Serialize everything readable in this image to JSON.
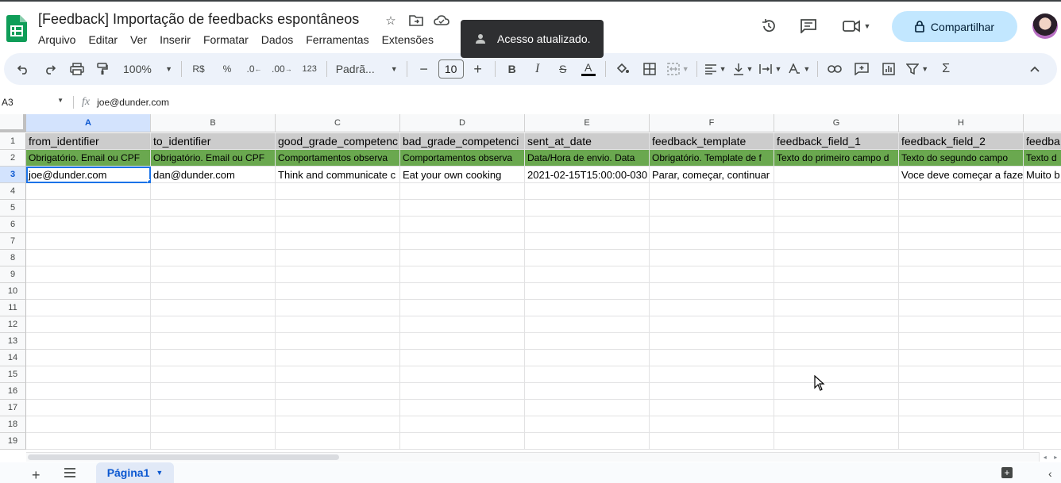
{
  "app": {
    "doc_title": "[Feedback] Importação de feedbacks espontâneos",
    "menu": [
      "Arquivo",
      "Editar",
      "Ver",
      "Inserir",
      "Formatar",
      "Dados",
      "Ferramentas",
      "Extensões"
    ],
    "toast": "Acesso atualizado.",
    "share_label": "Compartilhar"
  },
  "toolbar": {
    "zoom": "100%",
    "currency": "R$",
    "percent": "%",
    "dec_decrease": ".0",
    "dec_increase": ".00",
    "number_format": "123",
    "font": "Padrã...",
    "font_size": "10",
    "bold": "B",
    "italic": "I",
    "strike": "S",
    "text_color": "A",
    "sum": "Σ"
  },
  "formula_bar": {
    "name_box": "A3",
    "fx": "fx",
    "value": "joe@dunder.com"
  },
  "grid": {
    "columns": [
      "A",
      "B",
      "C",
      "D",
      "E",
      "F",
      "G",
      "H",
      ""
    ],
    "row_numbers": [
      "1",
      "2",
      "3",
      "4",
      "5",
      "6",
      "7",
      "8",
      "9",
      "10",
      "11",
      "12",
      "13",
      "14",
      "15",
      "16",
      "17",
      "18",
      "19"
    ],
    "rows": [
      [
        "from_identifier",
        "to_identifier",
        "good_grade_competenc",
        "bad_grade_competenci",
        "sent_at_date",
        "feedback_template",
        "feedback_field_1",
        "feedback_field_2",
        "feedba"
      ],
      [
        "Obrigatório. Email ou CPF",
        "Obrigatório. Email ou CPF",
        "Comportamentos observa",
        "Comportamentos observa",
        "Data/Hora de envio. Data",
        "Obrigatório. Template de f",
        "Texto do primeiro campo d",
        "Texto do segundo campo",
        "Texto d"
      ],
      [
        "joe@dunder.com",
        "dan@dunder.com",
        "Think and communicate c",
        "Eat your own cooking",
        "2021-02-15T15:00:00-030",
        "Parar, começar, continuar",
        "",
        "Voce deve começar a faze",
        "Muito b"
      ]
    ]
  },
  "sheets": {
    "active": "Página1"
  },
  "colors": {
    "header_row_bg": "#cccccc",
    "description_row_bg": "#6aa84f",
    "selection_blue": "#1a73e8",
    "share_bg": "#c2e7ff"
  }
}
